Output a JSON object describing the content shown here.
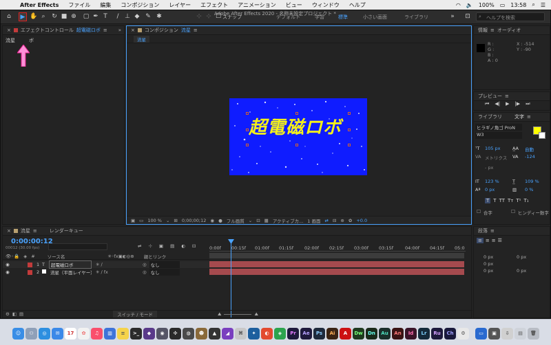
{
  "menubar": {
    "app_name": "After Effects",
    "items": [
      "ファイル",
      "編集",
      "コンポジション",
      "レイヤー",
      "エフェクト",
      "アニメーション",
      "ビュー",
      "ウィンドウ",
      "ヘルプ"
    ],
    "clock": "13:58",
    "battery": "100%"
  },
  "window": {
    "title": "Adobe After Effects 2020 - 名称未設定プロジェクト *"
  },
  "toolbar": {
    "snap_label": "スナップ",
    "workspaces": [
      "デフォルト",
      "学習",
      "標準",
      "小さい画面",
      "ライブラリ"
    ],
    "active_workspace": "標準",
    "help_search_placeholder": "ヘルプを検索"
  },
  "effect_controls": {
    "tab_label": "エフェクトコントロール",
    "tab_target": "超電磁ロボ",
    "breadcrumb_comp": "流星",
    "breadcrumb_layer": "ボ"
  },
  "composition": {
    "tab_label": "コンポジション",
    "tab_name": "流星",
    "flow_chip": "流星",
    "text_layer_content": "超電磁ロボ",
    "zoom": "100 %",
    "timecode": "0;00;00;12",
    "quality": "フル画質",
    "camera": "アクティブカ...",
    "views": "1 画面",
    "exposure": "+0.0"
  },
  "info_panel": {
    "tab_info": "情報",
    "tab_audio": "オーディオ",
    "r": "R :",
    "g": "G :",
    "b": "B :",
    "a": "A : 0",
    "x": "X : -514",
    "y": "Y : -90"
  },
  "preview_panel": {
    "title": "プレビュー"
  },
  "character_panel": {
    "tab_library": "ライブラリ",
    "tab_text": "文字",
    "font": "ヒラギノ角ゴ ProN",
    "weight": "W3",
    "size": "105 px",
    "leading": "自動",
    "kerning": "メトリクス",
    "tracking": "-124",
    "stroke": "- px",
    "vscale": "123 %",
    "hscale": "109 %",
    "baseline": "0 px",
    "tsume": "0 %",
    "ligature": "合字",
    "hindi": "ヒンディー数字",
    "fill_color": "#ffff00",
    "stroke_color": "#ffffff"
  },
  "paragraph_panel": {
    "title": "段落",
    "indent_a": "0 px",
    "indent_b": "0 px",
    "indent_c": "0 px",
    "space_a": "0 px",
    "space_b": "0 px"
  },
  "timeline": {
    "tab_comp": "流星",
    "tab_render": "レンダーキュー",
    "timecode": "0:00:00:12",
    "frame_info": "00012 (30.00 fps)",
    "col_source": "ソース名",
    "col_parent": "親とリンク",
    "switch_mode": "スイッチ / モード",
    "ruler": [
      "0:00f",
      "00:15f",
      "01:00f",
      "01:15f",
      "02:00f",
      "02:15f",
      "03:00f",
      "03:15f",
      "04:00f",
      "04:15f",
      "05:0"
    ],
    "layers": [
      {
        "num": "1",
        "type": "T",
        "name": "超電磁ロボ",
        "parent": "なし",
        "color": "#c23b3b"
      },
      {
        "num": "2",
        "type": "",
        "name": "流星（平面レイヤー）",
        "parent": "なし",
        "color": "#c23b3b"
      }
    ]
  },
  "dock": {
    "apps": [
      "Finder",
      "Launchpad",
      "Safari",
      "Mail",
      "Calendar",
      "Photos",
      "Music",
      "Keynote",
      "Notes",
      "Ps",
      "Pr",
      "Ae",
      "Lr",
      "Dw",
      "Dn",
      "Au",
      "An",
      "Id",
      "Lr",
      "Ru",
      "Ch",
      "Trash"
    ]
  }
}
